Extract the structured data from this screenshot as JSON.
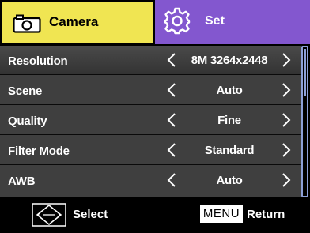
{
  "tabs": {
    "camera_label": "Camera",
    "set_label": "Set",
    "camera_icon": "camera-icon",
    "set_icon": "gear-icon",
    "active_tab": "Camera",
    "camera_bg": "#f0e552",
    "set_bg": "#8357cf"
  },
  "settings": [
    {
      "label": "Resolution",
      "value": "8M 3264x2448"
    },
    {
      "label": "Scene",
      "value": "Auto"
    },
    {
      "label": "Quality",
      "value": "Fine"
    },
    {
      "label": "Filter Mode",
      "value": "Standard"
    },
    {
      "label": "AWB",
      "value": "Auto"
    }
  ],
  "scrollbar": {
    "position": 0.0,
    "color": "#8da0d8"
  },
  "footer": {
    "select_icon": "dpad-icon",
    "select_label": "Select",
    "menu_key": "MENU",
    "return_label": "Return"
  }
}
